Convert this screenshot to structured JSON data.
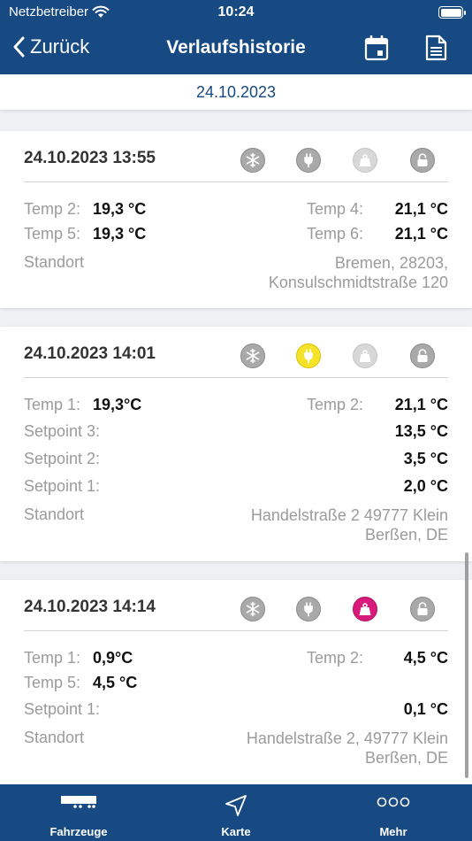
{
  "status": {
    "carrier": "Netzbetreiber",
    "time": "10:24"
  },
  "nav": {
    "back_label": "Zurück",
    "title": "Verlaufshistorie"
  },
  "date_header": "24.10.2023",
  "entries": [
    {
      "timestamp": "24.10.2023 13:55",
      "icons": {
        "cooling": "inactive",
        "power": "inactive",
        "weight": "disabled",
        "lock": "inactive"
      },
      "rows": [
        {
          "label": "Temp 2:",
          "value": "19,3 °C",
          "label2": "Temp 4:",
          "value2": "21,1 °C"
        },
        {
          "label": "Temp 5:",
          "value": "19,3 °C",
          "label2": "Temp 6:",
          "value2": "21,1 °C"
        }
      ],
      "location_label": "Standort",
      "location_line1": "Bremen, 28203,",
      "location_line2": "Konsulschmidtstraße 120"
    },
    {
      "timestamp": "24.10.2023 14:01",
      "icons": {
        "cooling": "inactive",
        "power": "active",
        "weight": "disabled",
        "lock": "inactive"
      },
      "rows": [
        {
          "label": "Temp 1:",
          "value": "19,3°C",
          "label2": "Temp 2:",
          "value2": "21,1 °C"
        }
      ],
      "setpoints": [
        {
          "label": "Setpoint 3:",
          "value": "13,5 °C"
        },
        {
          "label": "Setpoint 2:",
          "value": "3,5 °C"
        },
        {
          "label": "Setpoint 1:",
          "value": "2,0 °C"
        }
      ],
      "location_label": "Standort",
      "location_line1": "Handelstraße 2 49777 Klein",
      "location_line2": "Berßen, DE"
    },
    {
      "timestamp": "24.10.2023 14:14",
      "icons": {
        "cooling": "inactive",
        "power": "inactive",
        "weight": "alert",
        "lock": "inactive"
      },
      "rows": [
        {
          "label": "Temp 1:",
          "value": "0,9°C",
          "label2": "Temp 2:",
          "value2": "4,5 °C"
        },
        {
          "label": "Temp 5:",
          "value": "4,5 °C"
        }
      ],
      "setpoints": [
        {
          "label": "Setpoint 1:",
          "value": "0,1 °C"
        }
      ],
      "location_label": "Standort",
      "location_line1": "Handelstraße 2, 49777 Klein",
      "location_line2": "Berßen, DE"
    }
  ],
  "tabs": [
    {
      "label": "Fahrzeuge",
      "icon": "truck-icon"
    },
    {
      "label": "Karte",
      "icon": "navigation-arrow-icon"
    },
    {
      "label": "Mehr",
      "icon": "more-dots-icon"
    }
  ],
  "colors": {
    "primary": "#174a82",
    "alert_pink": "#d81b7a",
    "active_yellow": "#f5e22a"
  }
}
